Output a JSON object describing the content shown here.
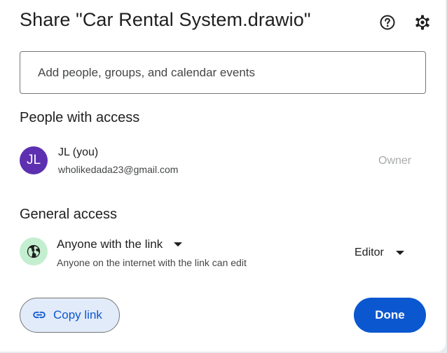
{
  "dialog": {
    "title": "Share \"Car Rental System.drawio\"",
    "help_icon": "help-circle-icon",
    "settings_icon": "gear-icon"
  },
  "add_people": {
    "placeholder": "Add people, groups, and calendar events",
    "value": ""
  },
  "people_with_access": {
    "heading": "People with access",
    "people": [
      {
        "initials": "JL",
        "name": "JL (you)",
        "email": "wholikedada23@gmail.com",
        "role": "Owner",
        "avatar_color": "#5d2fb1"
      }
    ]
  },
  "general_access": {
    "heading": "General access",
    "icon": "globe-icon",
    "scope": "Anyone with the link",
    "description": "Anyone on the internet with the link can edit",
    "role": "Editor"
  },
  "actions": {
    "copy_link": "Copy link",
    "copy_link_icon": "link-icon",
    "done": "Done"
  },
  "colors": {
    "primary": "#0b57d0",
    "copy_bg": "#e2ebf9",
    "globe_bg": "#c4eed0"
  }
}
